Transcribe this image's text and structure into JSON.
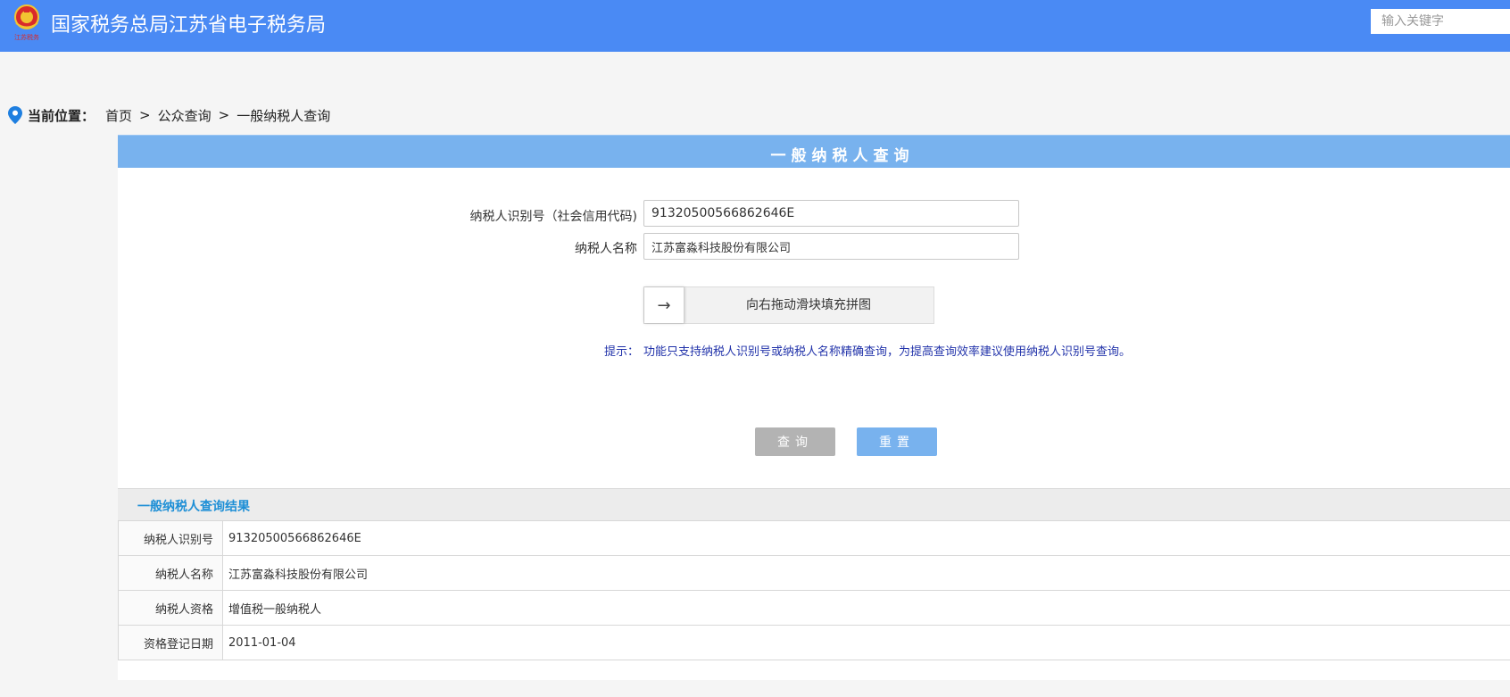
{
  "header": {
    "logo_text": "江苏税务",
    "title": "国家税务总局江苏省电子税务局",
    "search_placeholder": "输入关键字"
  },
  "breadcrumb": {
    "label": "当前位置：",
    "items": [
      "首页",
      "公众查询",
      "一般纳税人查询"
    ],
    "separator": ">"
  },
  "panel": {
    "title": "一般纳税人查询"
  },
  "form": {
    "tax_id_label": "纳税人识别号（社会信用代码)",
    "tax_id_value": "91320500566862646E",
    "name_label": "纳税人名称",
    "name_value": "江苏富淼科技股份有限公司",
    "slider_text": "向右拖动滑块填充拼图",
    "slider_arrow": "→",
    "tip_label": "提示：",
    "tip_text": "功能只支持纳税人识别号或纳税人名称精确查询，为提高查询效率建议使用纳税人识别号查询。"
  },
  "buttons": {
    "query": "查询",
    "reset": "重置"
  },
  "result": {
    "title": "一般纳税人查询结果",
    "rows": [
      {
        "label": "纳税人识别号",
        "value": "91320500566862646E"
      },
      {
        "label": "纳税人名称",
        "value": "江苏富淼科技股份有限公司"
      },
      {
        "label": "纳税人资格",
        "value": "增值税一般纳税人"
      },
      {
        "label": "资格登记日期",
        "value": "2011-01-04"
      }
    ]
  },
  "colors": {
    "header_bg": "#4a8af4",
    "panel_title_bg": "#78b2ee",
    "query_button": "#b3b3b3",
    "reset_button": "#78b2ee",
    "result_title": "#1e8fd6",
    "tip_text": "#2233aa"
  },
  "icons": {
    "logo": "tax-emblem-icon",
    "location": "map-pin-icon",
    "slider": "arrow-right-icon"
  }
}
